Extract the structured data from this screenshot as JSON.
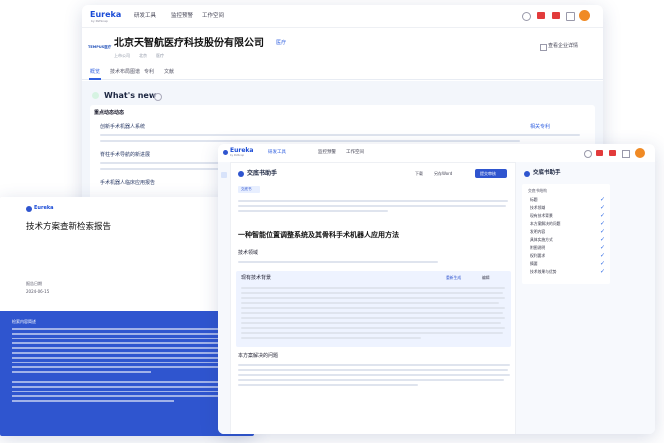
{
  "brand": {
    "name": "Eureka",
    "sub": "by PatSnap"
  },
  "main_window": {
    "nav": [
      "研发工具",
      "监控预警",
      "工作空间"
    ],
    "company_tag": "TEMPUS医疗",
    "company_name": "北京天智航医疗科技股份有限公司",
    "company_badge": "医疗",
    "company_meta": [
      "上市公司",
      "北京",
      "医疗"
    ],
    "follow_label": "查看企业详情",
    "tabs": [
      "概览",
      "技术布局图谱",
      "专利",
      "文献"
    ],
    "whats_new": "What's new",
    "section_label": "重点动态动态",
    "items": [
      {
        "title": "创新手术机器人系统",
        "link": "相关专利"
      },
      {
        "title": "脊柱手术导航的新进展",
        "link": ""
      },
      {
        "title": "手术机器人临床应用报告",
        "link": ""
      }
    ]
  },
  "report": {
    "logo": "Eureka",
    "title": "技术方案查新检索报告",
    "date_label": "报告日期",
    "date": "2024-06-15",
    "abstract_label": "检索内容简述",
    "abstract_lines": 15,
    "quote": "❞"
  },
  "tool": {
    "nav": [
      "研发工具",
      "监控预警",
      "工作空间"
    ],
    "panel_title": "交底书助手",
    "chip": "交底书",
    "toolbar": [
      "下载",
      "另存Word",
      "提交审核"
    ],
    "doc_title": "一种智能位置调整系统及其骨科手术机器人应用方法",
    "section1": "技术领域",
    "section2": "现有技术背景",
    "section2_actions": [
      "重新生成",
      "编辑"
    ],
    "section3": "本方案解决的问题",
    "side_title": "交底书助手",
    "side_group": "交底书结构",
    "checklist": [
      "标题",
      "技术领域",
      "现有技术背景",
      "本方案解决的问题",
      "发明内容",
      "具体实施方式",
      "附图说明",
      "权利要求",
      "摘要",
      "技术效果与优势"
    ]
  }
}
